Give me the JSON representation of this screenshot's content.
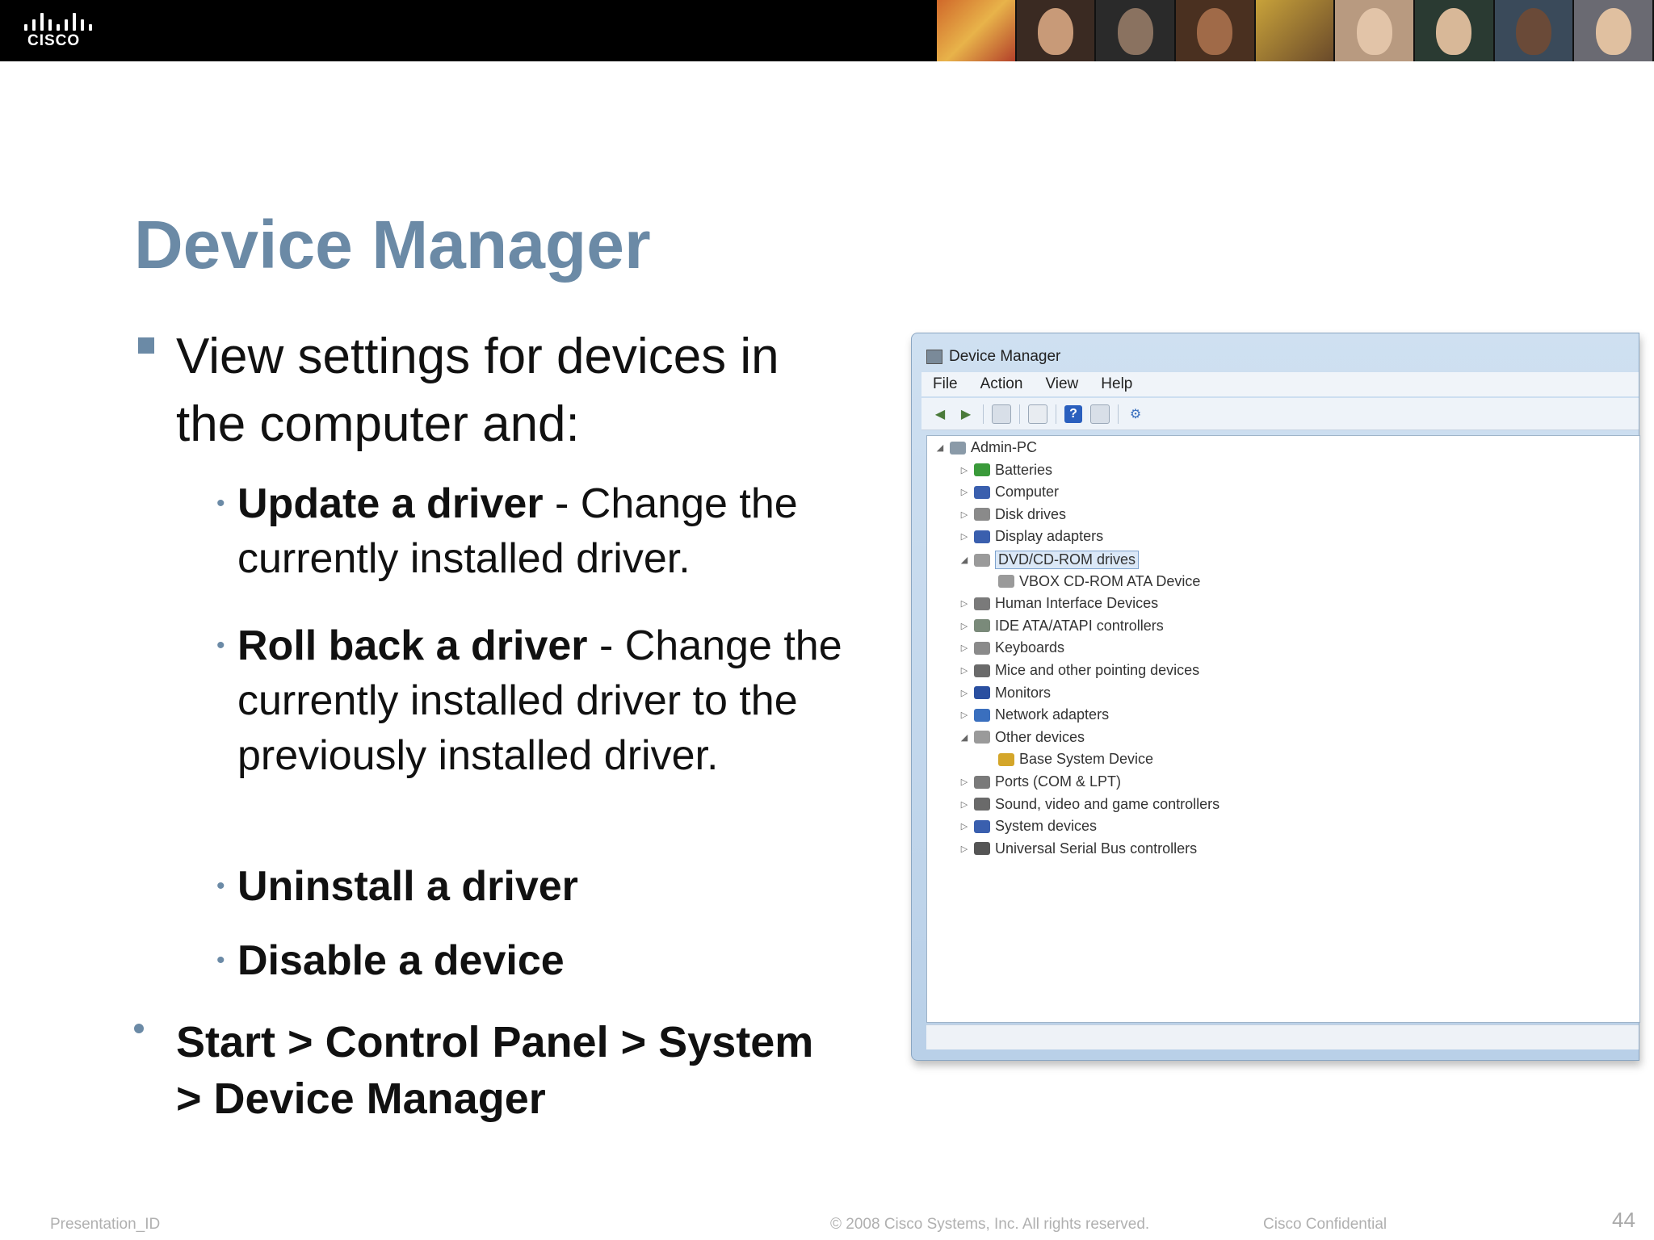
{
  "header": {
    "logo_text": "CISCO",
    "photo_count": 9
  },
  "slide": {
    "title": "Device Manager",
    "bullet1": "View settings for devices in the computer and:",
    "sub_items": [
      {
        "bold": "Update a driver",
        "rest": " - Change the currently installed driver."
      },
      {
        "bold": "Roll back a driver",
        "rest": " - Change the currently installed driver to the previously installed driver."
      },
      {
        "bold": "Uninstall a driver",
        "rest": ""
      },
      {
        "bold": "Disable a device",
        "rest": ""
      }
    ],
    "bullet2": "Start > Control Panel > System > Device Manager"
  },
  "window": {
    "title": "Device Manager",
    "menu": [
      "File",
      "Action",
      "View",
      "Help"
    ],
    "tree": [
      {
        "label": "Admin-PC",
        "level": 0,
        "expanded": true,
        "icon": "computer-icon",
        "color": "#8a9aa8"
      },
      {
        "label": "Batteries",
        "level": 1,
        "expanded": false,
        "icon": "battery-icon",
        "color": "#3a9a3a"
      },
      {
        "label": "Computer",
        "level": 1,
        "expanded": false,
        "icon": "computer-icon",
        "color": "#3a5fae"
      },
      {
        "label": "Disk drives",
        "level": 1,
        "expanded": false,
        "icon": "disk-icon",
        "color": "#8a8a8a"
      },
      {
        "label": "Display adapters",
        "level": 1,
        "expanded": false,
        "icon": "display-icon",
        "color": "#3a5fae"
      },
      {
        "label": "DVD/CD-ROM drives",
        "level": 1,
        "expanded": true,
        "icon": "dvd-icon",
        "color": "#9a9a9a",
        "selected": true
      },
      {
        "label": "VBOX CD-ROM ATA Device",
        "level": 2,
        "expanded": null,
        "icon": "dvd-icon",
        "color": "#9a9a9a"
      },
      {
        "label": "Human Interface Devices",
        "level": 1,
        "expanded": false,
        "icon": "hid-icon",
        "color": "#7a7a7a"
      },
      {
        "label": "IDE ATA/ATAPI controllers",
        "level": 1,
        "expanded": false,
        "icon": "ide-icon",
        "color": "#7a8a7a"
      },
      {
        "label": "Keyboards",
        "level": 1,
        "expanded": false,
        "icon": "keyboard-icon",
        "color": "#8a8a8a"
      },
      {
        "label": "Mice and other pointing devices",
        "level": 1,
        "expanded": false,
        "icon": "mouse-icon",
        "color": "#6a6a6a"
      },
      {
        "label": "Monitors",
        "level": 1,
        "expanded": false,
        "icon": "monitor-icon",
        "color": "#2a4fa0"
      },
      {
        "label": "Network adapters",
        "level": 1,
        "expanded": false,
        "icon": "network-icon",
        "color": "#3a6fbe"
      },
      {
        "label": "Other devices",
        "level": 1,
        "expanded": true,
        "icon": "other-icon",
        "color": "#9a9a9a"
      },
      {
        "label": "Base System Device",
        "level": 2,
        "expanded": null,
        "icon": "warning-icon",
        "color": "#d4a62a"
      },
      {
        "label": "Ports (COM & LPT)",
        "level": 1,
        "expanded": false,
        "icon": "port-icon",
        "color": "#7a7a7a"
      },
      {
        "label": "Sound, video and game controllers",
        "level": 1,
        "expanded": false,
        "icon": "sound-icon",
        "color": "#6a6a6a"
      },
      {
        "label": "System devices",
        "level": 1,
        "expanded": false,
        "icon": "system-icon",
        "color": "#3a5fae"
      },
      {
        "label": "Universal Serial Bus controllers",
        "level": 1,
        "expanded": false,
        "icon": "usb-icon",
        "color": "#555555"
      }
    ]
  },
  "footer": {
    "presentation_id": "Presentation_ID",
    "copyright": "© 2008 Cisco Systems, Inc. All rights reserved.",
    "confidential": "Cisco Confidential",
    "page": "44"
  },
  "colors": {
    "accent": "#6b8aa6",
    "header_bg": "#000000"
  }
}
